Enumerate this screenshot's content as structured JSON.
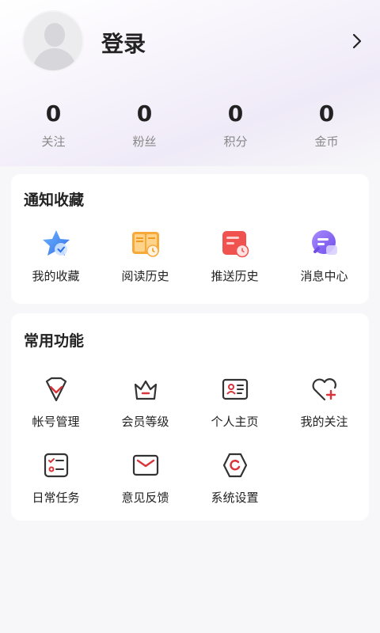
{
  "profile": {
    "login_label": "登录"
  },
  "stats": [
    {
      "value": "0",
      "label": "关注"
    },
    {
      "value": "0",
      "label": "粉丝"
    },
    {
      "value": "0",
      "label": "积分"
    },
    {
      "value": "0",
      "label": "金币"
    }
  ],
  "notify_section": {
    "title": "通知收藏",
    "items": [
      {
        "label": "我的收藏",
        "icon": "star-icon"
      },
      {
        "label": "阅读历史",
        "icon": "book-clock-icon"
      },
      {
        "label": "推送历史",
        "icon": "calendar-clock-icon"
      },
      {
        "label": "消息中心",
        "icon": "chat-bubble-icon"
      }
    ]
  },
  "common_section": {
    "title": "常用功能",
    "items": [
      {
        "label": "帐号管理",
        "icon": "shield-check-icon"
      },
      {
        "label": "会员等级",
        "icon": "crown-icon"
      },
      {
        "label": "个人主页",
        "icon": "id-card-icon"
      },
      {
        "label": "我的关注",
        "icon": "heart-plus-icon"
      },
      {
        "label": "日常任务",
        "icon": "task-list-icon"
      },
      {
        "label": "意见反馈",
        "icon": "mail-icon"
      },
      {
        "label": "系统设置",
        "icon": "settings-hex-icon"
      }
    ]
  },
  "colors": {
    "accent": "#d9343a",
    "icon_dark": "#333333"
  }
}
